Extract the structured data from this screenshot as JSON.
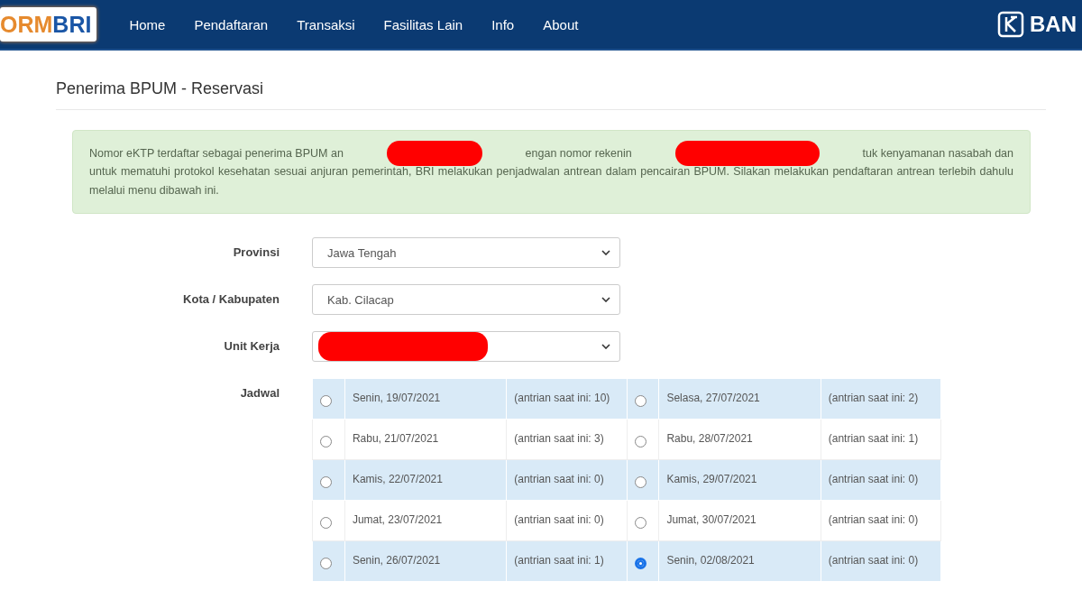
{
  "navbar": {
    "logo": {
      "part_1": "ORM",
      "part_2": "BRI"
    },
    "items": [
      "Home",
      "Pendaftaran",
      "Transaksi",
      "Fasilitas Lain",
      "Info",
      "About"
    ],
    "brand": "BAN"
  },
  "page_title": "Penerima BPUM - Reservasi",
  "alert": {
    "segments": [
      "Nomor eKTP terdaftar sebagai penerima BPUM an",
      "engan nomor rekenin",
      "tuk kenyamanan nasabah dan"
    ],
    "continuation": "untuk mematuhi protokol kesehatan sesuai anjuran pemerintah, BRI melakukan penjadwalan antrean dalam pencairan BPUM. Silakan melakukan pendaftaran antrean terlebih dahulu melalui menu dibawah ini."
  },
  "form": [
    {
      "label": "Provinsi",
      "value": "Jawa Tengah"
    },
    {
      "label": "Kota / Kabupaten",
      "value": "Kab. Cilacap"
    },
    {
      "label": "Unit Kerja"
    }
  ],
  "schedule": {
    "label": "Jadwal",
    "slots": [
      {
        "date": "Senin, 19/07/2021",
        "queue": "(antrian saat ini: 10)",
        "selected": false
      },
      {
        "date": "Selasa, 27/07/2021",
        "queue": "(antrian saat ini: 2)",
        "selected": false
      },
      {
        "date": "Rabu, 21/07/2021",
        "queue": "(antrian saat ini: 3)",
        "selected": false
      },
      {
        "date": "Rabu, 28/07/2021",
        "queue": "(antrian saat ini: 1)",
        "selected": false
      },
      {
        "date": "Kamis, 22/07/2021",
        "queue": "(antrian saat ini: 0)",
        "selected": false
      },
      {
        "date": "Kamis, 29/07/2021",
        "queue": "(antrian saat ini: 0)",
        "selected": false
      },
      {
        "date": "Jumat, 23/07/2021",
        "queue": "(antrian saat ini: 0)",
        "selected": false
      },
      {
        "date": "Jumat, 30/07/2021",
        "queue": "(antrian saat ini: 0)",
        "selected": false
      },
      {
        "date": "Senin, 26/07/2021",
        "queue": "(antrian saat ini: 1)",
        "selected": false
      },
      {
        "date": "Senin, 02/08/2021",
        "queue": "(antrian saat ini: 0)",
        "selected": true
      }
    ]
  }
}
